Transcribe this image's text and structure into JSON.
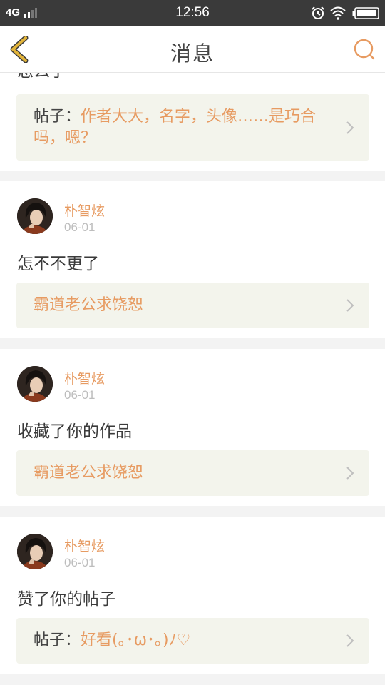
{
  "status_bar": {
    "network": "4G",
    "time": "12:56"
  },
  "header": {
    "title": "消息"
  },
  "colors": {
    "accent": "#e79b62",
    "back_icon": "#e2b43a",
    "post_bg": "#f3f4ec"
  },
  "icons": {
    "back": "chevron-left-icon",
    "search": "search-icon",
    "arrow": "chevron-right-icon"
  },
  "notifications": [
    {
      "comment": "怎么了",
      "post": {
        "prefix": "帖子：",
        "title": "作者大大，名字，头像……是巧合吗，嗯？"
      }
    },
    {
      "user": "朴智炫",
      "date": "06-01",
      "comment": "怎不不更了",
      "post": {
        "prefix": "",
        "title": "霸道老公求饶恕"
      }
    },
    {
      "user": "朴智炫",
      "date": "06-01",
      "comment": "收藏了你的作品",
      "post": {
        "prefix": "",
        "title": "霸道老公求饶恕"
      }
    },
    {
      "user": "朴智炫",
      "date": "06-01",
      "comment": "赞了你的帖子",
      "post": {
        "prefix": "帖子：",
        "title": "好看(｡･ω･｡)ﾉ♡"
      }
    }
  ]
}
